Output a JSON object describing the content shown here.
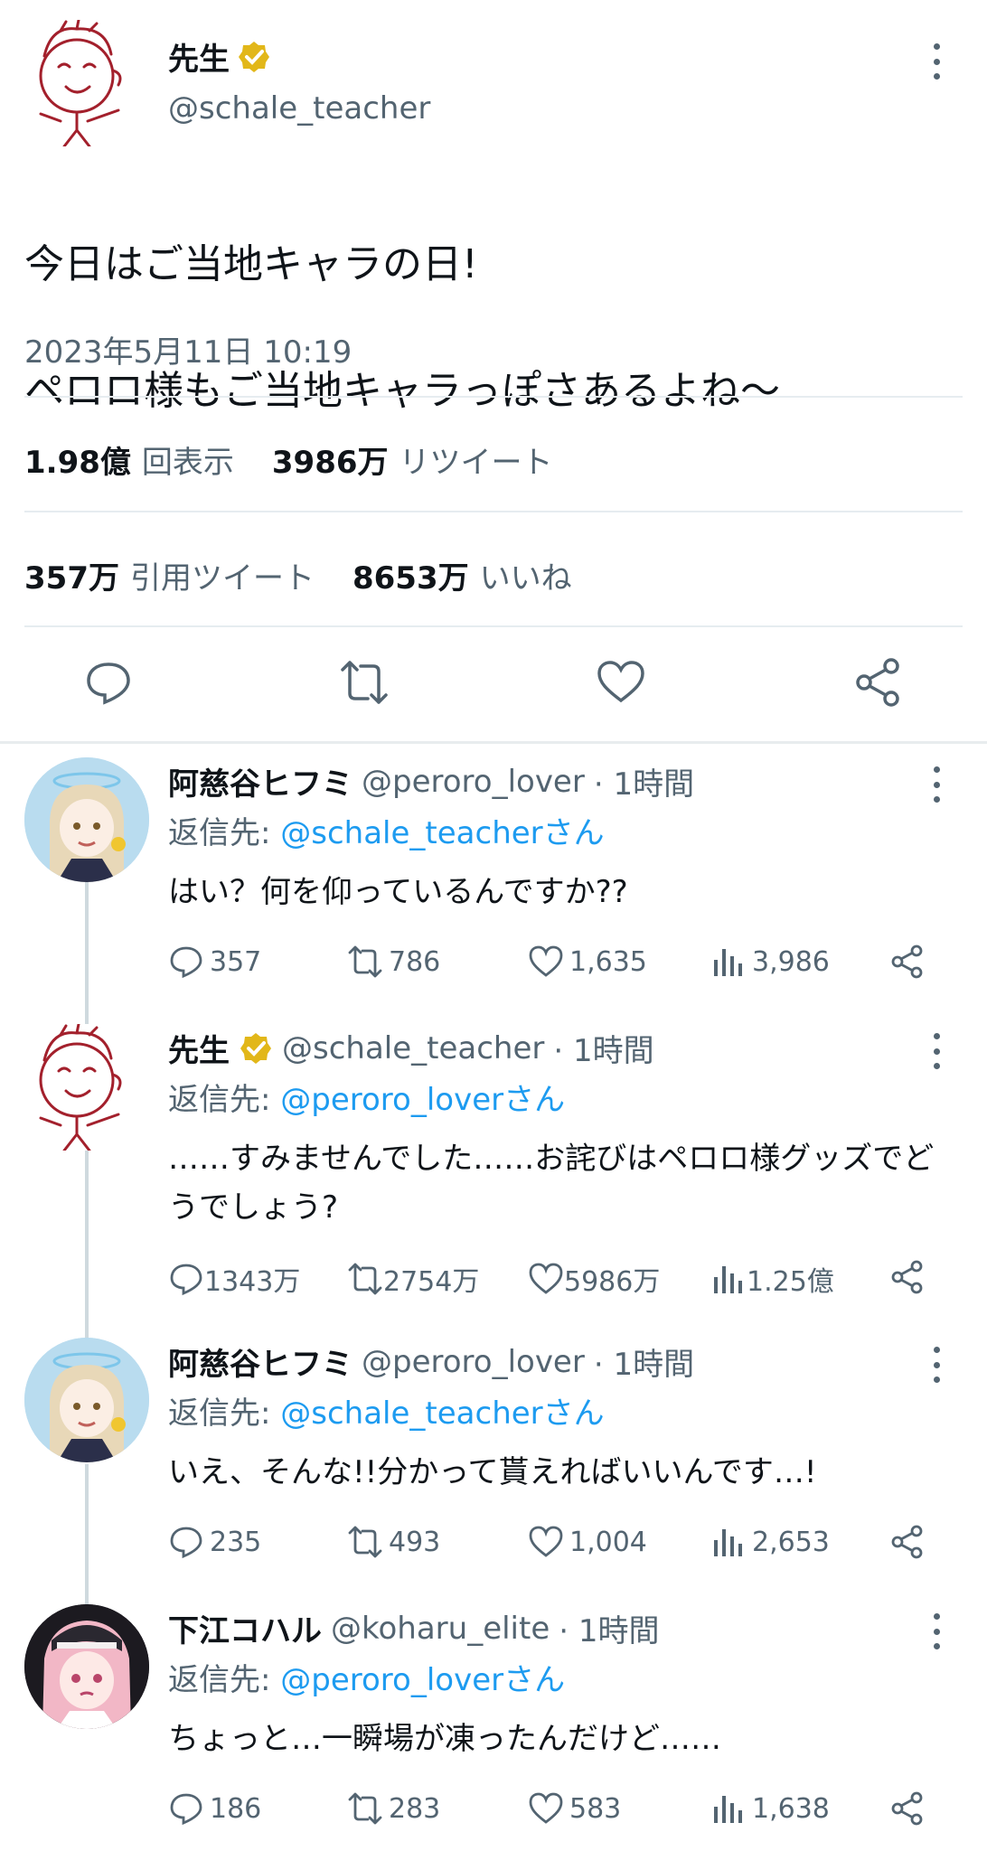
{
  "main_tweet": {
    "author_name": "先生",
    "handle": "@schale_teacher",
    "text_lines": [
      "今日はご当地キャラの日!",
      "ペロロ様もご当地キャラっぽさあるよね〜"
    ],
    "timestamp": "2023年5月11日 10:19",
    "stats": {
      "views_value": "1.98億",
      "views_label": "回表示",
      "retweets_value": "3986万",
      "retweets_label": "リツイート",
      "quotes_value": "357万",
      "quotes_label": "引用ツイート",
      "likes_value": "8653万",
      "likes_label": "いいね"
    },
    "actions": [
      "reply-icon",
      "retweet-icon",
      "like-icon",
      "share-icon"
    ]
  },
  "replies": [
    {
      "name": "阿慈谷ヒフミ",
      "handle": "@peroro_lover",
      "time": "· 1時間",
      "reply_prefix": "返信先: ",
      "reply_to": "@schale_teacherさん",
      "text": "はい？何を仰っているんですか??",
      "replies": "357",
      "retweets": "786",
      "likes": "1,635",
      "views": "3,986"
    },
    {
      "name": "先生",
      "handle": "@schale_teacher",
      "time": "· 1時間",
      "reply_prefix": "返信先: ",
      "reply_to": "@peroro_loverさん",
      "text": "……すみませんでした……お詫びはペロロ様グッズでどうでしょう?",
      "replies": "1343万",
      "retweets": "2754万",
      "likes": "5986万",
      "views": "1.25億"
    },
    {
      "name": "阿慈谷ヒフミ",
      "handle": "@peroro_lover",
      "time": "· 1時間",
      "reply_prefix": "返信先: ",
      "reply_to": "@schale_teacherさん",
      "text": "いえ、そんな!!分かって貰えればいいんです…!",
      "replies": "235",
      "retweets": "493",
      "likes": "1,004",
      "views": "2,653"
    },
    {
      "name": "下江コハル",
      "handle": "@koharu_elite",
      "time": "· 1時間",
      "reply_prefix": "返信先: ",
      "reply_to": "@peroro_loverさん",
      "text": "ちょっと…一瞬場が凍ったんだけど……",
      "replies": "186",
      "retweets": "283",
      "likes": "583",
      "views": "1,638"
    }
  ],
  "colors": {
    "link": "#1d9bf0",
    "muted": "#536471",
    "text": "#0f1419",
    "avatar_drawing": "#a3202c",
    "verified": "#e2b719"
  }
}
